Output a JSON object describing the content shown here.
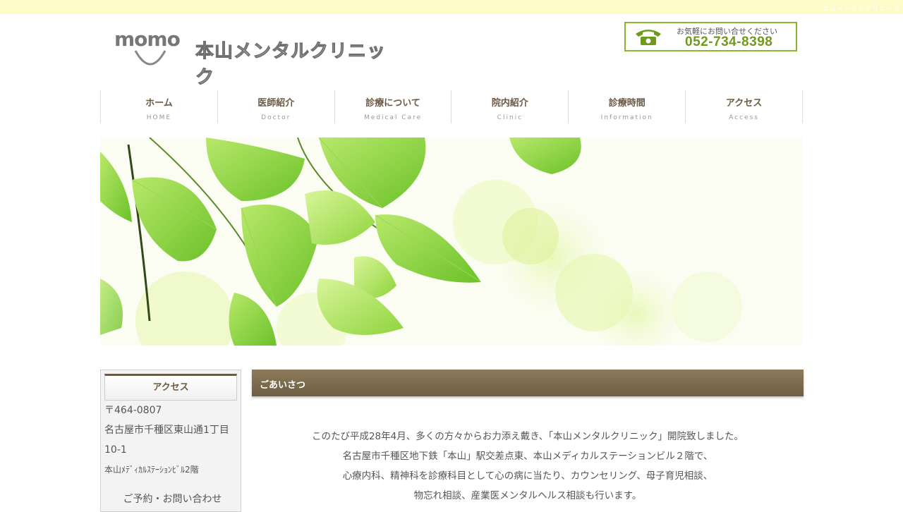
{
  "header": {
    "tagline": "本山メンタルクリニック",
    "logo_text": "momo",
    "clinic_name": "本山メンタルクリニック",
    "phone_note": "お気軽にお問い合せください",
    "phone_number": "052-734-8398"
  },
  "nav": [
    {
      "label": "ホーム",
      "sub": "HOME"
    },
    {
      "label": "医師紹介",
      "sub": "Doctor"
    },
    {
      "label": "診療について",
      "sub": "Medical Care"
    },
    {
      "label": "院内紹介",
      "sub": "Clinic"
    },
    {
      "label": "診療時間",
      "sub": "Information"
    },
    {
      "label": "アクセス",
      "sub": "Access"
    }
  ],
  "sidebar": {
    "title": "アクセス",
    "postal": "〒464-0807",
    "address1": "名古屋市千種区東山通1丁目",
    "address2": "10-1",
    "building": "本山ﾒﾃﾞｨｶﾙｽﾃｰｼｮﾝﾋﾞﾙ2階",
    "more": "ご予約・お問い合わせ"
  },
  "main": {
    "title": "ごあいさつ",
    "paragraphs": [
      "このたび平成28年4月、多くの方々からお力添え戴き、「本山メンタルクリニック」開院致しました。",
      "名古屋市千種区地下鉄「本山」駅交差点東、本山メディカルステーションビル２階で、",
      "心療内科、精神科を診療科目として心の病に当たり、カウンセリング、母子育児相談、",
      "物忘れ相談、産業医メンタルヘルス相談も行います。"
    ]
  },
  "colors": {
    "accent_brown": "#6b5a43",
    "phone_green": "#8db32a",
    "topbar": "#fdfcc8"
  }
}
